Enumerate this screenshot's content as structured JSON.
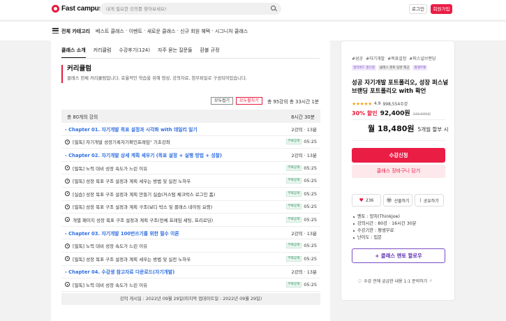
{
  "header": {
    "logo_text": "Fast campus",
    "search_placeholder": "내게 필요한 강의를 찾아보세요!",
    "login_label": "로그인",
    "signup_label": "회원가입"
  },
  "nav": {
    "category_label": "전체 카테고리",
    "links": [
      "베스트 클래스",
      "이벤트",
      "새로운 클래스",
      "신규 회원 혜택",
      "시그니처 클래스"
    ],
    "separator": " · "
  },
  "tabs": [
    "클래스 소개",
    "커리큘럼",
    "수강후기(124)",
    "자주 묻는 질문들",
    "환불 규정"
  ],
  "curriculum": {
    "title": "커리큘럼",
    "description": "클래스 전체 커리큘럼입니다. 효율적인 학습을 위해 영상, 강의자료, 첨부파일로 구성되어있습니다.",
    "collapse_label": "모두접기",
    "expand_label": "모두펼치기",
    "stats": "총 95강의  총 33시간 1분",
    "list_header_left": "총 80개의 강의",
    "list_header_right": "8시간 30분",
    "free_label": "무료공개",
    "rows": [
      {
        "type": "chapter",
        "title": "- Chapter 01. 자기개발 목표 설정과 시각화 with 데일리 일기",
        "meta": "2강의 · 13분"
      },
      {
        "type": "lesson",
        "title": "[필독] 자기개발 성장기록자기확인프레임\" 기초강좌",
        "free": true,
        "duration": "05:25"
      },
      {
        "type": "chapter",
        "title": "- Chapter 02. 자기개발 상세 계획 세우기 (목표 설정 + 실행 방법 + 성찰)",
        "meta": "2강의 · 13분"
      },
      {
        "type": "lesson",
        "title": "[필독] 노력 대비 성장 속도가 느린 이유",
        "free": true,
        "duration": "05:25"
      },
      {
        "type": "lesson",
        "title": "[필독] 성장 목표 구조 설정과 계획 세우는 방법 및 실전 노하우",
        "free": true,
        "duration": "05:25"
      },
      {
        "type": "lesson",
        "title": "[실습] 성장 목표 구조 설정과 계획 만들기 실습(커스텀 체크박스 로그인 폼)",
        "free": true,
        "duration": "05:25"
      },
      {
        "type": "lesson",
        "title": "[필독] 성장 목표 구조 설정과 계획 구조(보디 박스 및 클래스 네이밍 요령)",
        "free": true,
        "duration": "05:25"
      },
      {
        "type": "lesson",
        "title": "개별 페이지 성장 목표 구조 설정과 계획 구조(전체 프레임 세팅, 프리로딩)",
        "free": true,
        "duration": "05:25"
      },
      {
        "type": "chapter",
        "title": "- Chapter 03. 자기개발 100번쓰기를 위한 필수 이론",
        "meta": "2강의 · 13분"
      },
      {
        "type": "lesson",
        "title": "[필독] 노력 대비 성장 속도가 느린 이유",
        "free": true,
        "duration": "05:25"
      },
      {
        "type": "lesson",
        "title": "[필독] 성장 목표 구조 설정과 계획 세우는 방법 및 실전 노하우",
        "free": true,
        "duration": "05:25"
      },
      {
        "type": "chapter",
        "title": "- Chapter 04. 수강생 참고자료 다운로드(자기개발)",
        "meta": "2강의 · 13분"
      },
      {
        "type": "lesson",
        "title": "[필독] 노력 대비 성장 속도가 느린 이유",
        "free": true,
        "duration": "05:25"
      }
    ],
    "footer": "강의 게시일 : 2022년 09월 29일(마지막 업데이트일 : 2022년 09월 29일)"
  },
  "sidebar": {
    "tags": [
      "#성공",
      "#자기개발",
      "#목표설정",
      "#퍼스널브랜딩"
    ],
    "badges": [
      "얼리버드 할인중",
      "클래스 멘토 답변 제공",
      "평생무료"
    ],
    "title": "성공 자기개발 포트폴리오, 성장 퍼스널 브랜딩 포트폴리오 with 확언",
    "stars": "★★★★★",
    "rating": "4.9",
    "reviews": "998,554수강",
    "discount": "30% 할인",
    "price": "92,400원",
    "original_price": "132,000원",
    "monthly_price": "월 18,480원",
    "installment": "5개월 할부 시",
    "apply_label": "수강신청",
    "cart_label": "클래스 장바구니 담기",
    "like_count": "236",
    "gift_label": "선물하기",
    "share_label": "공유하기",
    "info": [
      "멘토 : 망자(Thinkjoe)",
      "강의시간 : 80강 · 16시간 30분",
      "수강기한 : 평생무료",
      "난이도 : 입문"
    ],
    "follow_label": "+ 클래스 멘토 팔로우",
    "qna_label": "수강 전에 궁금한 내용 1:1 문의하기"
  },
  "colors": {
    "brand": "#ea1d45",
    "chapter": "#2e6de0",
    "follow": "#5b2bb3"
  }
}
